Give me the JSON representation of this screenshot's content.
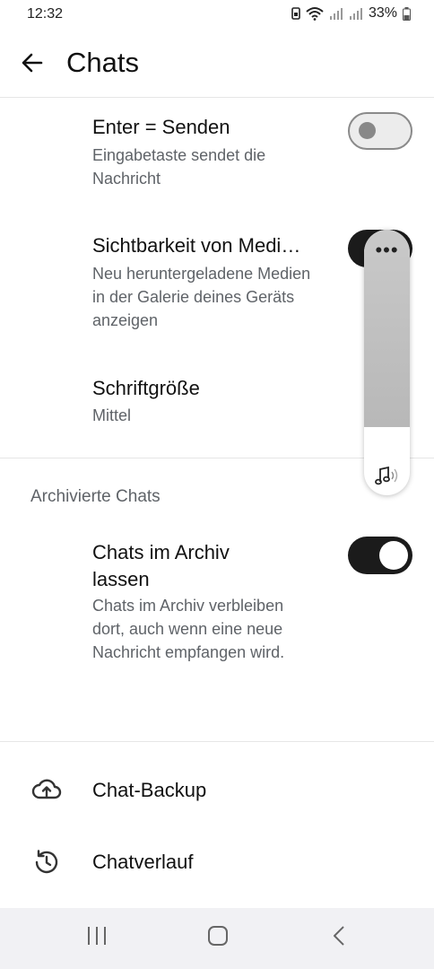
{
  "status_bar": {
    "time": "12:32",
    "battery": "33%"
  },
  "app_bar": {
    "title": "Chats"
  },
  "settings": {
    "enter_send": {
      "title": "Enter = Senden",
      "desc": "Eingabetaste sendet die Nachricht",
      "state": "off"
    },
    "media_visibility": {
      "title": "Sichtbarkeit von Medi…",
      "desc": "Neu heruntergeladene Medien in der Galerie deines Geräts anzeigen",
      "state": "on"
    },
    "font_size": {
      "title": "Schriftgröße",
      "value": "Mittel"
    }
  },
  "archived_section": {
    "header": "Archivierte Chats",
    "keep_archived": {
      "title": "Chats im Archiv lassen",
      "desc": "Chats im Archiv verbleiben dort, auch wenn eine neue Nachricht empfangen wird.",
      "state": "on"
    }
  },
  "links": {
    "backup": "Chat-Backup",
    "history": "Chatverlauf"
  },
  "floating_panel": {
    "menu": "•••"
  },
  "icons": {
    "back": "arrow-left-icon",
    "backup": "cloud-upload-icon",
    "history": "history-icon",
    "music": "music-note-icon"
  },
  "colors": {
    "toggle_on": "#1b1b1b",
    "toggle_off": "#ececec",
    "text_secondary": "#5f6368"
  }
}
